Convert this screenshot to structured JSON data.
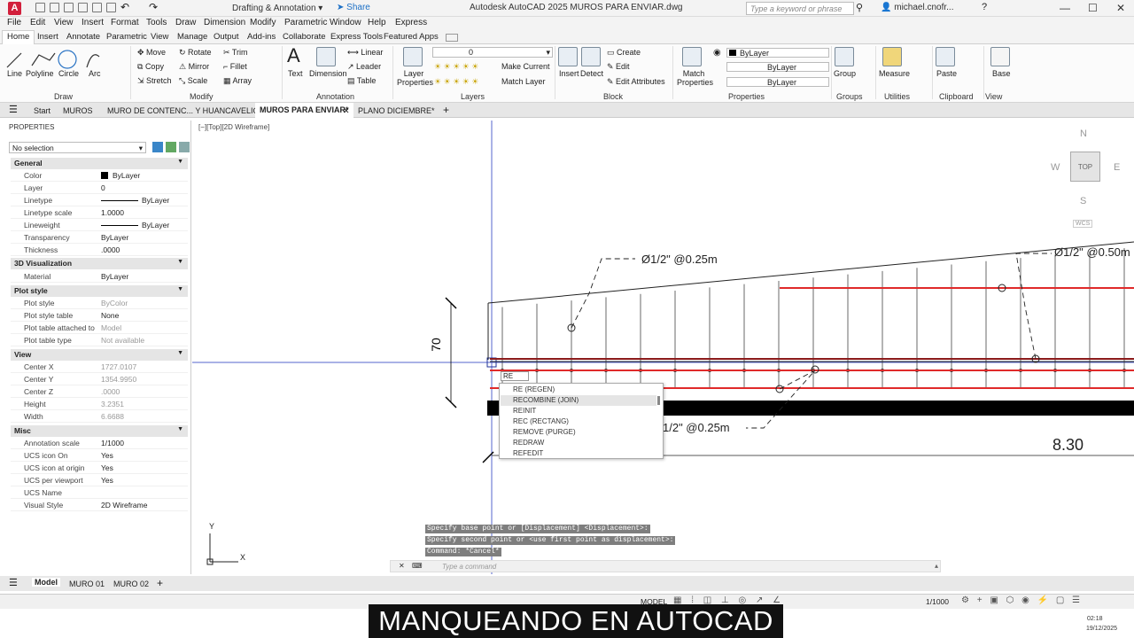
{
  "app": {
    "logo": "A",
    "workspace": "Drafting & Annotation",
    "share": "Share",
    "title": "Autodesk AutoCAD 2025    MUROS PARA ENVIAR.dwg",
    "search_placeholder": "Type a keyword or phrase",
    "user": "michael.cnofr..."
  },
  "menu": [
    "File",
    "Edit",
    "View",
    "Insert",
    "Format",
    "Tools",
    "Draw",
    "Dimension",
    "Modify",
    "Parametric",
    "Window",
    "Help",
    "Express"
  ],
  "ribbon_tabs": [
    "Home",
    "Insert",
    "Annotate",
    "Parametric",
    "View",
    "Manage",
    "Output",
    "Add-ins",
    "Collaborate",
    "Express Tools",
    "Featured Apps"
  ],
  "draw": {
    "line": "Line",
    "polyline": "Polyline",
    "circle": "Circle",
    "arc": "Arc",
    "title": "Draw"
  },
  "modify": {
    "move": "Move",
    "rotate": "Rotate",
    "trim": "Trim",
    "copy": "Copy",
    "mirror": "Mirror",
    "fillet": "Fillet",
    "stretch": "Stretch",
    "scale": "Scale",
    "array": "Array",
    "title": "Modify"
  },
  "annotation": {
    "text": "Text",
    "dimension": "Dimension",
    "linear": "Linear",
    "leader": "Leader",
    "table": "Table",
    "title": "Annotation"
  },
  "layers": {
    "layer_properties": "Layer Properties",
    "layer_value": "0",
    "make_current": "Make Current",
    "match_layer": "Match Layer",
    "title": "Layers"
  },
  "block": {
    "insert": "Insert",
    "detect": "Detect",
    "create": "Create",
    "edit": "Edit",
    "edit_attributes": "Edit Attributes",
    "title": "Block"
  },
  "properties_panel": {
    "match": "Match Properties",
    "bylayer1": "ByLayer",
    "bylayer2": "ByLayer",
    "bylayer3": "ByLayer",
    "title": "Properties"
  },
  "groups": {
    "group": "Group",
    "title": "Groups"
  },
  "utilities": {
    "measure": "Measure",
    "title": "Utilities"
  },
  "clipboard": {
    "paste": "Paste",
    "title": "Clipboard"
  },
  "view_panel": {
    "base": "Base",
    "title": "View"
  },
  "file_tabs": [
    "Start",
    "MUROS",
    "MURO DE CONTENC... Y HUANCAVELICA*",
    "MUROS PARA ENVIAR*",
    "PLANO DICIEMBRE*"
  ],
  "props": {
    "header": "PROPERTIES",
    "selection": "No selection",
    "sections": {
      "general": "General",
      "viz": "3D Visualization",
      "plot": "Plot style",
      "view": "View",
      "misc": "Misc"
    },
    "general": [
      [
        "Color",
        "ByLayer"
      ],
      [
        "Layer",
        "0"
      ],
      [
        "Linetype",
        "ByLayer"
      ],
      [
        "Linetype scale",
        "1.0000"
      ],
      [
        "Lineweight",
        "ByLayer"
      ],
      [
        "Transparency",
        "ByLayer"
      ],
      [
        "Thickness",
        ".0000"
      ]
    ],
    "viz": [
      [
        "Material",
        "ByLayer"
      ]
    ],
    "plot": [
      [
        "Plot style",
        "ByColor"
      ],
      [
        "Plot style table",
        "None"
      ],
      [
        "Plot table attached to",
        "Model"
      ],
      [
        "Plot table type",
        "Not available"
      ]
    ],
    "view": [
      [
        "Center X",
        "1727.0107"
      ],
      [
        "Center Y",
        "1354.9950"
      ],
      [
        "Center Z",
        ".0000"
      ],
      [
        "Height",
        "3.2351"
      ],
      [
        "Width",
        "6.6688"
      ]
    ],
    "misc": [
      [
        "Annotation scale",
        "1/1000"
      ],
      [
        "UCS icon On",
        "Yes"
      ],
      [
        "UCS icon at origin",
        "Yes"
      ],
      [
        "UCS per viewport",
        "Yes"
      ],
      [
        "UCS Name",
        ""
      ],
      [
        "Visual Style",
        "2D Wireframe"
      ]
    ]
  },
  "viewport": {
    "label": "[−][Top][2D Wireframe]",
    "compass_n": "N",
    "compass_s": "S",
    "compass_e": "E",
    "compass_w": "W",
    "cube": "TOP",
    "wcs": "WCS"
  },
  "drawing": {
    "note1": "Ø1/2\" @0.25m",
    "note2": "Ø1/2\" @0.50m",
    "note3": "1/2\" @0.25m",
    "dim70": "70",
    "dim830": "8.30"
  },
  "autocomplete": {
    "input": "RE",
    "items": [
      "RE (REGEN)",
      "RECOMBINE (JOIN)",
      "REINIT",
      "REC (RECTANG)",
      "REMOVE (PURGE)",
      "REDRAW",
      "REFEDIT"
    ]
  },
  "command": {
    "h1": "Specify base point or [Displacement] <Displacement>:",
    "h2": "Specify second point or <use first point as displacement>:",
    "h3": "Command: *Cancel*",
    "placeholder": "Type a command"
  },
  "layout_tabs": [
    "Model",
    "MURO 01",
    "MURO 02"
  ],
  "status": {
    "model": "MODEL",
    "scale": "1/1000"
  },
  "caption": "MANQUEANDO EN AUTOCAD",
  "tray": {
    "time": "02:18",
    "date": "19/12/2025"
  }
}
